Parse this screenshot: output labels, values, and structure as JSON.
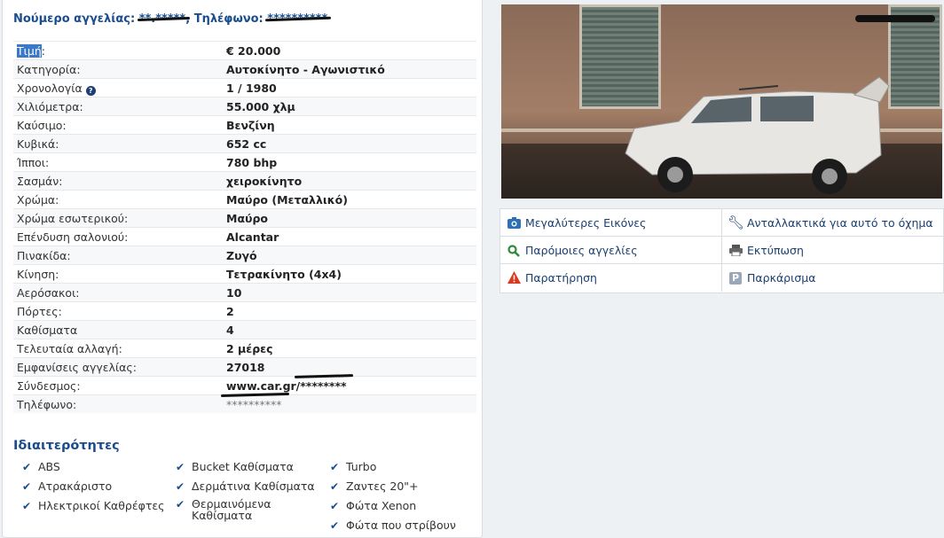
{
  "header": {
    "ad_number_label": "Νούμερο αγγελίας:",
    "ad_number_value": "**.*****",
    "phone_label": "Τηλέφωνο:",
    "phone_value": "**********"
  },
  "specs": [
    {
      "label": "Τιμή",
      "value": "€ 20.000"
    },
    {
      "label": "Κατηγορία:",
      "value": "Αυτοκίνητο - Αγωνιστικό"
    },
    {
      "label": "Χρονολογία",
      "value": "1 / 1980"
    },
    {
      "label": "Χιλιόμετρα:",
      "value": "55.000 χλμ"
    },
    {
      "label": "Καύσιμο:",
      "value": "Βενζίνη"
    },
    {
      "label": "Κυβικά:",
      "value": "652 cc"
    },
    {
      "label": "Ίπποι:",
      "value": "780 bhp"
    },
    {
      "label": "Σασμάν:",
      "value": "χειροκίνητο"
    },
    {
      "label": "Χρώμα:",
      "value": "Μαύρο (Μεταλλικό)"
    },
    {
      "label": "Χρώμα εσωτερικού:",
      "value": "Μαύρο"
    },
    {
      "label": "Επένδυση σαλονιού:",
      "value": "Alcantar"
    },
    {
      "label": "Πινακίδα:",
      "value": "Ζυγό"
    },
    {
      "label": "Κίνηση:",
      "value": "Τετρακίνητο (4x4)"
    },
    {
      "label": "Αερόσακοι:",
      "value": "10"
    },
    {
      "label": "Πόρτες:",
      "value": "2"
    },
    {
      "label": "Καθίσματα",
      "value": "4"
    },
    {
      "label": "Τελευταία αλλαγή:",
      "value": "2 μέρες"
    },
    {
      "label": "Εμφανίσεις αγγελίας:",
      "value": "27018"
    },
    {
      "label": "Σύνδεσμος:",
      "value": "www.car.gr/",
      "redacted_suffix": "********"
    },
    {
      "label": "Τηλέφωνο:",
      "value": "**********"
    }
  ],
  "features": {
    "title": "Ιδιαιτερότητες",
    "col1": [
      "ABS",
      "Ατρακάριστο",
      "Ηλεκτρικοί Καθρέφτες"
    ],
    "col2": [
      "Bucket Καθίσματα",
      "Δερμάτινα Καθίσματα",
      "Θερμαινόμενα Καθίσματα"
    ],
    "col3": [
      "Turbo",
      "Ζαντες 20\"+",
      "Φώτα Xenon",
      "Φώτα που στρίβουν"
    ]
  },
  "actions": {
    "larger_images": "Μεγαλύτερες Εικόνες",
    "spare_parts": "Ανταλλακτικά για αυτό το όχημα",
    "similar_ads": "Παρόμοιες αγγελίες",
    "print": "Εκτύπωση",
    "report": "Παρατήρηση",
    "parking": "Παρκάρισμα",
    "parking_glyph": "P"
  },
  "colors": {
    "accent": "#1a4d8f",
    "warning": "#d9391f",
    "success": "#2e8b3a",
    "camera": "#2f6fb5"
  }
}
